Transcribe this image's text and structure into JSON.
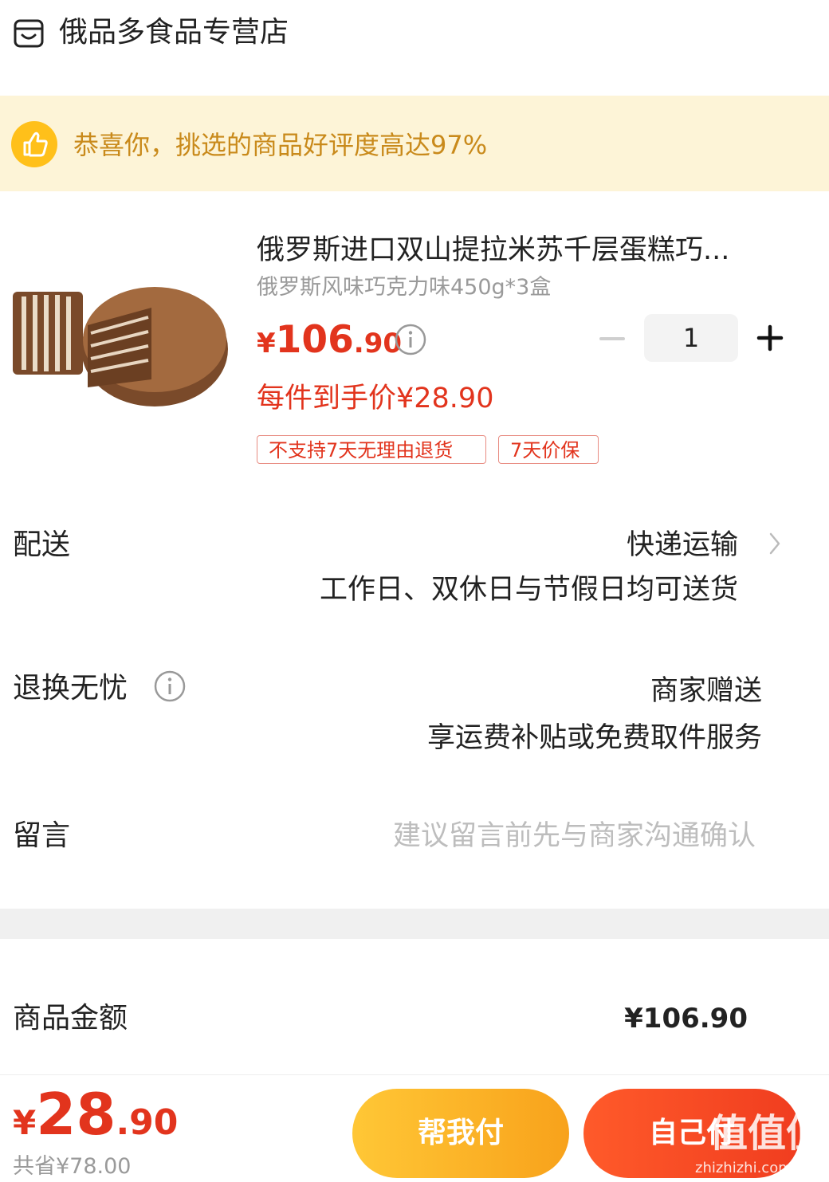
{
  "store": {
    "name": "俄品多食品专营店",
    "icon": "shop-icon"
  },
  "banner": {
    "icon": "thumbs-up-icon",
    "text": "恭喜你，挑选的商品好评度高达97%"
  },
  "product": {
    "title": "俄罗斯进口双山提拉米苏千层蛋糕巧...",
    "spec": "俄罗斯风味巧克力味450g*3盒",
    "price": {
      "currency": "¥",
      "integer": "106",
      "decimal": ".90"
    },
    "quantity": "1",
    "unit_price": "每件到手价¥28.90",
    "tags": [
      "不支持7天无理由退货",
      "7天价保"
    ]
  },
  "delivery": {
    "label": "配送",
    "method": "快递运输",
    "detail": "工作日、双休日与节假日均可送货"
  },
  "returns": {
    "label": "退换无忧",
    "value": "商家赠送",
    "detail": "享运费补贴或免费取件服务"
  },
  "message": {
    "label": "留言",
    "placeholder": "建议留言前先与商家沟通确认"
  },
  "amount": {
    "label": "商品金额",
    "value": "¥106.90"
  },
  "checkout": {
    "total": {
      "currency": "¥",
      "integer": "28",
      "decimal": ".90"
    },
    "saved": "共省¥78.00",
    "help_pay_label": "帮我付",
    "self_pay_label": "自己付"
  },
  "watermark": {
    "logo": "值值值",
    "url": "zhizhizhi.com"
  },
  "colors": {
    "price_red": "#e2341d",
    "banner_bg": "#fdf4d7",
    "banner_text": "#c98a1b",
    "help_pay_gradient": [
      "#ffc736",
      "#f8a21b"
    ],
    "self_pay_gradient": [
      "#ff5a2a",
      "#f03d1f"
    ]
  }
}
